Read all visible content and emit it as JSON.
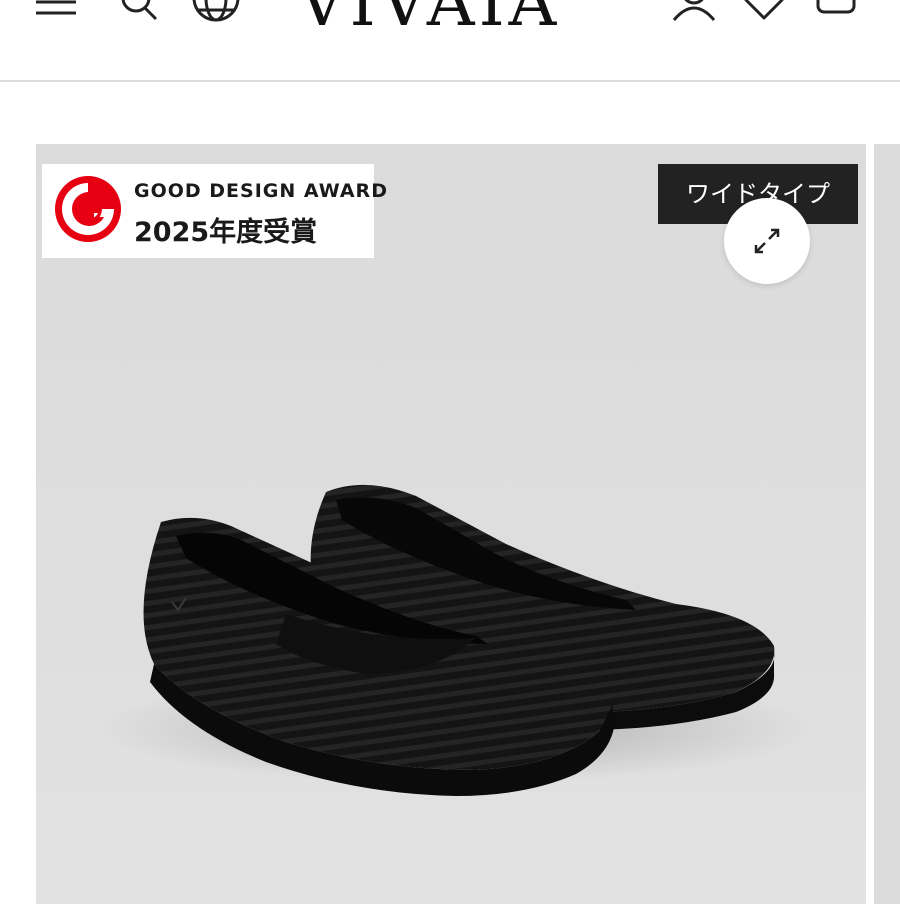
{
  "header": {
    "logo": "VIVAIA",
    "menu_icon": "menu-icon",
    "search_icon": "search-icon",
    "language_icon": "globe-icon",
    "account_icon": "user-icon",
    "wishlist_icon": "heart-icon",
    "cart_icon": "bag-icon"
  },
  "gallery": {
    "award": {
      "line1": "GOOD DESIGN AWARD",
      "line2": "2025年度受賞",
      "mark_color": "#e60012"
    },
    "tag": "ワイドタイプ",
    "expand_icon": "expand-icon",
    "product_image": "black-knit-flat-shoes"
  },
  "colors": {
    "header_bg": "#ffffff",
    "divider": "#dcdcdc",
    "gallery_bg": "#dddddd",
    "tag_bg": "#222222",
    "tag_text": "#ffffff"
  }
}
